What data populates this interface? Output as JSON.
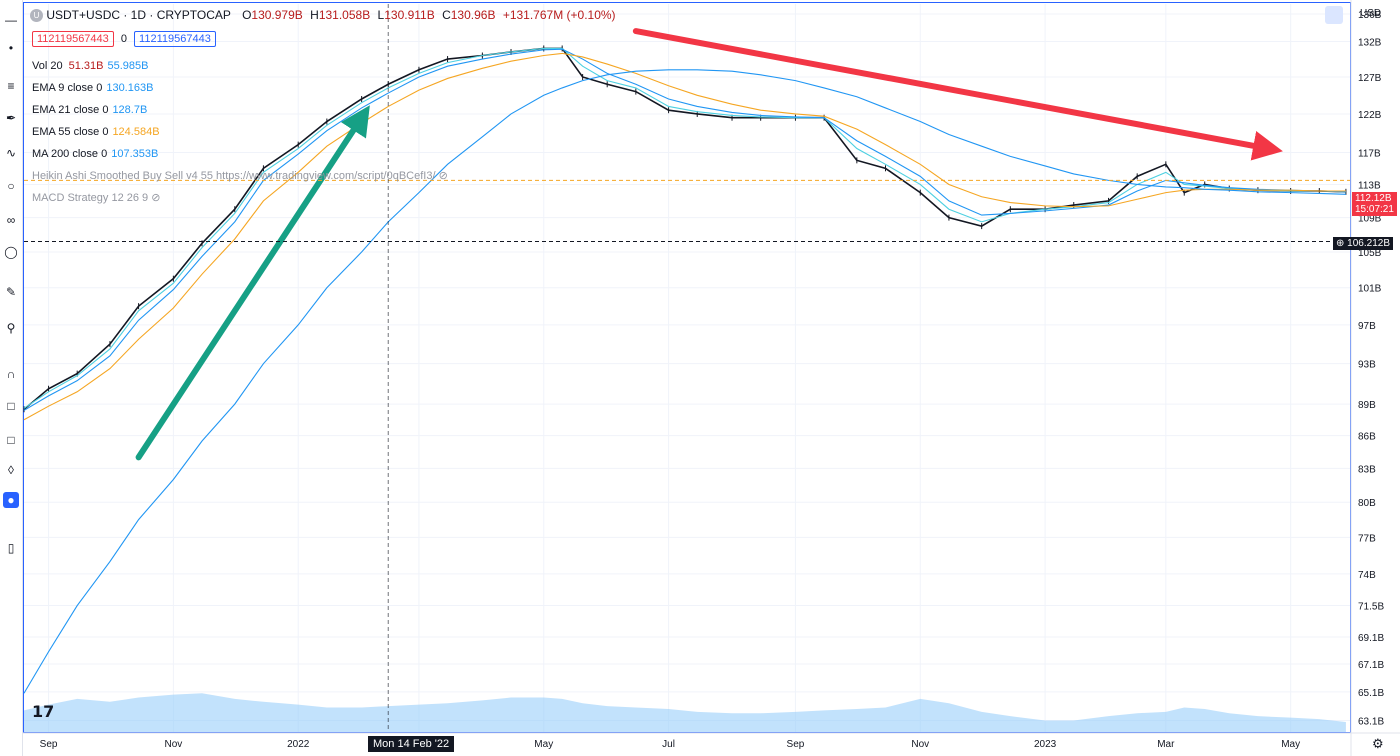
{
  "header": {
    "logo_letter": "U",
    "symbol_title": "USDT+USDC · 1D · CRYPTOCAP",
    "ohlc": {
      "open_label": "O",
      "open": "130.979B",
      "high_label": "H",
      "high": "131.058B",
      "low_label": "L",
      "low": "130.911B",
      "close_label": "C",
      "close": "130.96B",
      "change": "+131.767M (+0.10%)"
    },
    "id_left": "112119567443",
    "id_sep": "0",
    "id_right": "112119567443"
  },
  "indicators": [
    {
      "name": "Vol 20",
      "v1": "51.31B",
      "v2": "55.985B",
      "c1": "#b71c1c",
      "c2": "#2196f3"
    },
    {
      "name": "EMA 9 close 0",
      "v1": "",
      "v2": "130.163B",
      "c1": "",
      "c2": "#2196f3"
    },
    {
      "name": "EMA 21 close 0",
      "v1": "",
      "v2": "128.7B",
      "c1": "",
      "c2": "#2196f3"
    },
    {
      "name": "EMA 55 close 0",
      "v1": "",
      "v2": "124.584B",
      "c1": "",
      "c2": "#f5a623"
    },
    {
      "name": "MA 200 close 0",
      "v1": "",
      "v2": "107.353B",
      "c1": "",
      "c2": "#2196f3"
    }
  ],
  "hidden_indicators": [
    "Heikin Ashi Smoothed Buy Sell v4 55 https://www.tradingview.com/script/0qBCefI3/",
    "MACD Strategy 12 26 9"
  ],
  "price_axis": {
    "currency": "USD",
    "ticks": [
      "136B",
      "132B",
      "127B",
      "122B",
      "117B",
      "113B",
      "109B",
      "105B",
      "101B",
      "97B",
      "93B",
      "89B",
      "86B",
      "83B",
      "80B",
      "77B",
      "74B",
      "71.5B",
      "69.1B",
      "67.1B",
      "65.1B",
      "63.1B"
    ],
    "current_price": "112.12B",
    "countdown": "15:07:21",
    "crosshair_price": "106.212B"
  },
  "time_axis": {
    "ticks": [
      "Sep",
      "Nov",
      "2022",
      "Mar",
      "May",
      "Jul",
      "Sep",
      "Nov",
      "2023",
      "Mar",
      "May"
    ],
    "crosshair_date": "Mon 14 Feb '22"
  },
  "colors": {
    "accent": "#2962ff",
    "ema9": "#4dd0e1",
    "ema21": "#2196f3",
    "ema55": "#f5a623",
    "ma200": "#2196f3",
    "volume": "#90caf9",
    "up_arrow": "#16a085",
    "down_arrow": "#f23645",
    "price_badge": "#f23645"
  },
  "chart_data": {
    "type": "line",
    "x": [
      "2021-08-20",
      "2021-09-01",
      "2021-09-15",
      "2021-10-01",
      "2021-10-15",
      "2021-11-01",
      "2021-11-15",
      "2021-12-01",
      "2021-12-15",
      "2022-01-01",
      "2022-01-15",
      "2022-02-01",
      "2022-02-14",
      "2022-03-01",
      "2022-03-15",
      "2022-04-01",
      "2022-04-15",
      "2022-05-01",
      "2022-05-10",
      "2022-05-20",
      "2022-06-01",
      "2022-06-15",
      "2022-07-01",
      "2022-07-15",
      "2022-08-01",
      "2022-08-15",
      "2022-09-01",
      "2022-09-15",
      "2022-10-01",
      "2022-10-15",
      "2022-11-01",
      "2022-11-15",
      "2022-12-01",
      "2022-12-15",
      "2023-01-01",
      "2023-01-15",
      "2023-02-01",
      "2023-02-15",
      "2023-03-01",
      "2023-03-10",
      "2023-03-20",
      "2023-04-01",
      "2023-04-15",
      "2023-05-01",
      "2023-05-15",
      "2023-05-28"
    ],
    "series": [
      {
        "name": "USDT+USDC",
        "values": [
          88.5,
          90.5,
          92,
          95,
          99,
          102,
          106,
          110,
          115,
          118,
          121,
          124,
          126,
          128,
          129.5,
          130,
          130.5,
          131,
          131,
          127,
          126,
          125,
          122.5,
          122,
          121.5,
          121.5,
          121.5,
          121.5,
          116,
          115,
          112,
          109,
          108,
          110,
          110,
          110.5,
          111,
          114,
          115.5,
          112,
          113,
          112.5,
          112.3,
          112.2,
          112.2,
          112.1
        ]
      },
      {
        "name": "EMA 9 close 0",
        "values": [
          88.6,
          90.2,
          91.8,
          94.5,
          98.5,
          101.5,
          105.5,
          109.5,
          114.5,
          117.5,
          120.5,
          123.5,
          125.5,
          127.5,
          129,
          130,
          130.5,
          131,
          131,
          128.5,
          126.5,
          125.5,
          123,
          122.3,
          121.8,
          121.6,
          121.5,
          121.5,
          117.5,
          115.5,
          113,
          110,
          108.5,
          109.5,
          110,
          110.3,
          110.8,
          113,
          114.5,
          113,
          112.8,
          112.5,
          112.3,
          112.2,
          112.2,
          112.1
        ]
      },
      {
        "name": "EMA 21 close 0",
        "values": [
          88.4,
          89.8,
          91.3,
          93.8,
          97.5,
          100.8,
          104.5,
          108.5,
          113.5,
          116.8,
          119.8,
          122.8,
          124.8,
          127,
          128.5,
          129.5,
          130.2,
          130.8,
          130.9,
          129.5,
          127.5,
          126,
          124,
          123,
          122.2,
          121.8,
          121.6,
          121.5,
          118.5,
          116.5,
          114,
          111,
          109.3,
          109.5,
          109.8,
          110.1,
          110.5,
          112.2,
          113.5,
          113.2,
          112.9,
          112.6,
          112.4,
          112.3,
          112.2,
          112.1
        ]
      },
      {
        "name": "EMA 55 close 0",
        "values": [
          87.5,
          88.8,
          90.2,
          92.5,
          95.5,
          98.8,
          102.5,
          106.5,
          111,
          114.5,
          117.8,
          120.8,
          123,
          125.2,
          126.8,
          128.2,
          129.2,
          130,
          130.3,
          129.8,
          128.8,
          127.5,
          125.8,
          124.5,
          123.3,
          122.5,
          122,
          121.7,
          120,
          118,
          115.5,
          113,
          111.5,
          110.8,
          110.4,
          110.3,
          110.4,
          111.2,
          112,
          112.3,
          112.4,
          112.4,
          112.3,
          112.3,
          112.2,
          112.2
        ]
      },
      {
        "name": "MA 200 close 0",
        "values": [
          65,
          68,
          71.5,
          75,
          78.5,
          82,
          85.5,
          89,
          93,
          97,
          101,
          105,
          108.5,
          112,
          115.5,
          119,
          122,
          124.5,
          125.5,
          126.5,
          127.3,
          127.8,
          128,
          128,
          127.8,
          127.3,
          126.5,
          125.5,
          124.3,
          122.8,
          121,
          119.3,
          117.8,
          116.5,
          115.3,
          114.3,
          113.5,
          113,
          112.7,
          112.6,
          112.4,
          112.3,
          112.1,
          112,
          111.9,
          111.8
        ]
      }
    ],
    "volume": [
      63.8,
      64.2,
      64.6,
      64.4,
      64.7,
      64.9,
      65.0,
      64.6,
      64.4,
      64.2,
      64.0,
      64.0,
      64.1,
      64.2,
      64.3,
      64.5,
      64.7,
      64.7,
      64.6,
      64.3,
      64.1,
      64.0,
      63.9,
      63.7,
      63.6,
      63.6,
      63.7,
      63.8,
      63.9,
      64.0,
      64.6,
      64.3,
      63.7,
      63.4,
      63.1,
      63.1,
      63.4,
      63.6,
      63.7,
      64.0,
      63.9,
      63.6,
      63.4,
      63.3,
      63.2,
      63.0
    ],
    "title": "USDT+USDC · 1D · CRYPTOCAP",
    "ylim": [
      63,
      136
    ],
    "yscale": "log",
    "grid": true,
    "annotations": [
      {
        "type": "arrow",
        "color": "#16a085",
        "from": [
          "2021-10-15",
          84
        ],
        "to": [
          "2022-02-01",
          121.5
        ]
      },
      {
        "type": "arrow",
        "color": "#f23645",
        "from": [
          "2022-06-15",
          133.5
        ],
        "to": [
          "2023-04-20",
          117.5
        ]
      },
      {
        "type": "hline",
        "color": "#f5a623",
        "style": "dashed",
        "y": 113.5
      },
      {
        "type": "hline",
        "color": "#131722",
        "style": "dashed",
        "y": 106.212
      },
      {
        "type": "vline",
        "color": "#131722",
        "style": "dashed",
        "x": "2022-02-14"
      }
    ]
  }
}
